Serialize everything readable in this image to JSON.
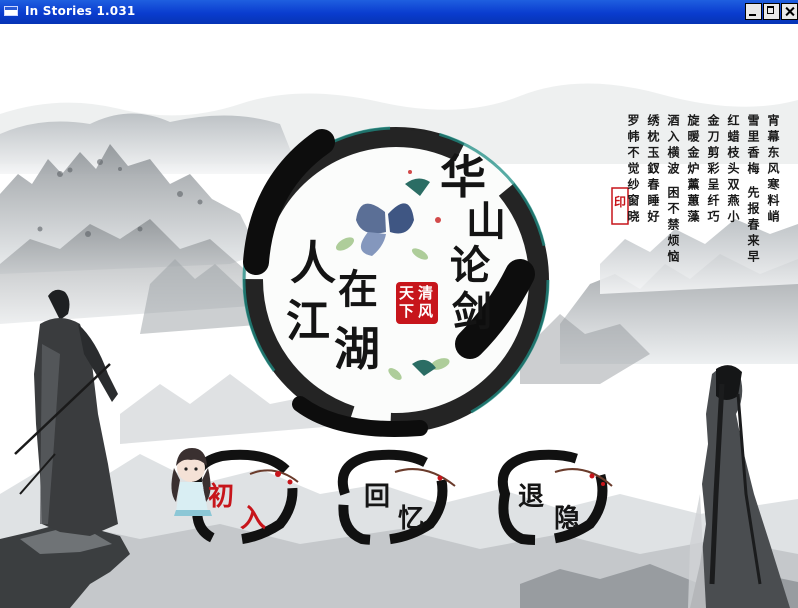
{
  "window": {
    "title": "In Stories 1.031"
  },
  "titlebar_buttons": {
    "minimize": "minimize",
    "maximize": "maximize",
    "close": "close"
  },
  "title_art": {
    "line1": [
      "华",
      "山",
      "论",
      "剑"
    ],
    "line2": [
      "人",
      "在",
      "江",
      "湖"
    ],
    "seal": [
      "天",
      "清",
      "下",
      "风"
    ]
  },
  "poem": {
    "columns": [
      "宵幕东风寒料峭",
      "雪里香梅 先报春来早",
      "红蜡枝头双燕小",
      "金刀剪彩呈纤巧",
      "旋暖金炉薰蕙藻",
      "酒入横波 困不禁烦恼",
      "绣枕玉釵春睡好",
      "罗帏不觉纱窗晓"
    ],
    "stamp": "印"
  },
  "menu": {
    "new_game": [
      "初",
      "入"
    ],
    "load_game": [
      "回",
      "忆"
    ],
    "quit": [
      "退",
      "隐"
    ]
  },
  "colors": {
    "titlebar": "#0a3ccf",
    "ink": "#141414",
    "seal_red": "#c7151b",
    "teal": "#1f8f86"
  }
}
